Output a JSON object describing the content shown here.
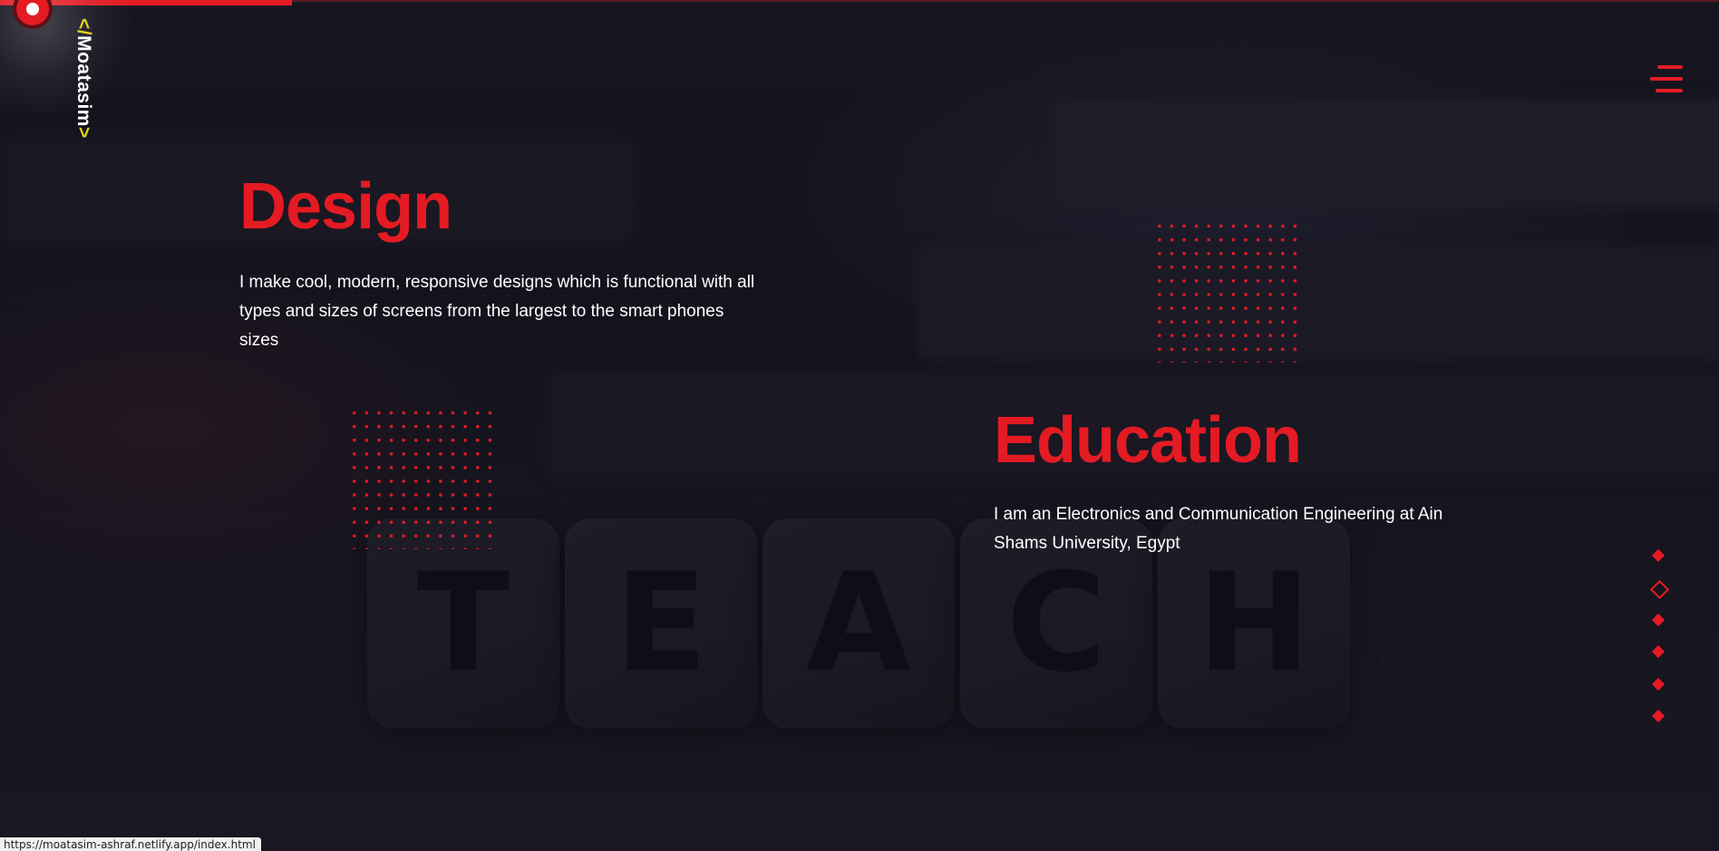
{
  "brand": {
    "logo_open": "</",
    "logo_name": "Moatasim",
    "logo_close": ">",
    "accent_color": "#e41b23",
    "logo_bracket_color": "#e3d21a"
  },
  "header": {
    "menu_icon": "hamburger-menu-icon",
    "scroll_progress_percent": 17
  },
  "sections": {
    "design": {
      "title": "Design",
      "text": "I make cool, modern, responsive designs which is functional with all types and sizes of screens from the largest to the smart phones sizes"
    },
    "education": {
      "title": "Education",
      "text": "I am an Electronics and Communication Engineering at Ain Shams University, Egypt"
    }
  },
  "background": {
    "dice_letters": [
      "T",
      "E",
      "A",
      "C",
      "H"
    ]
  },
  "side_nav": {
    "count": 6,
    "active_index": 1
  },
  "status_bar": {
    "url": "https://moatasim-ashraf.netlify.app/index.html"
  }
}
